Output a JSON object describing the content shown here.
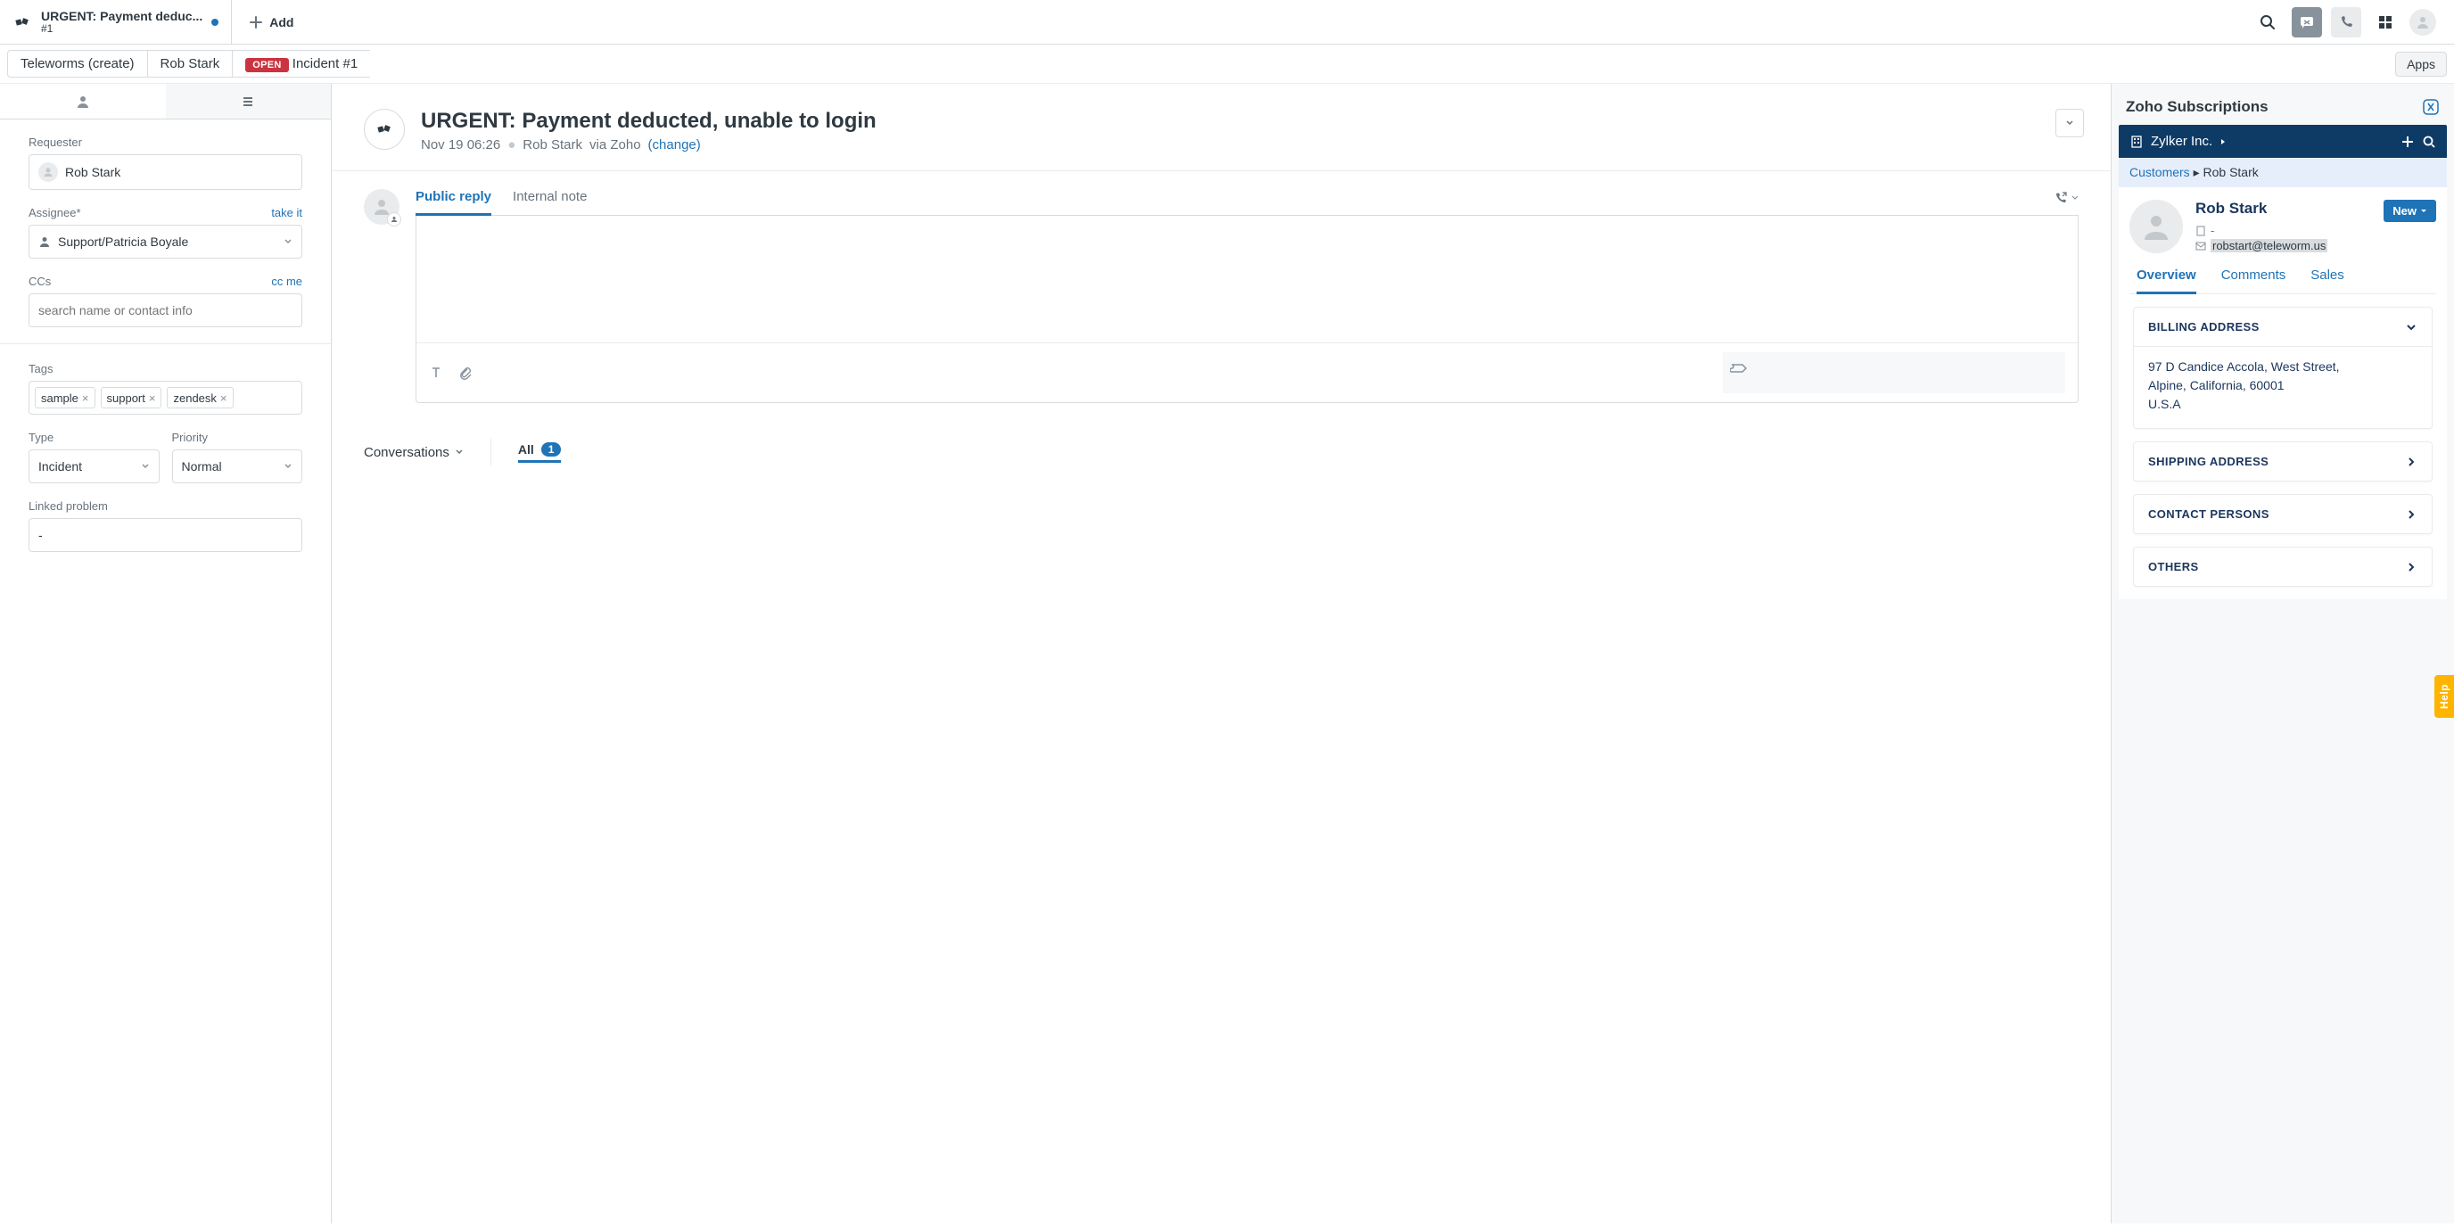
{
  "topTab": {
    "title": "URGENT: Payment deduc...",
    "sub": "#1",
    "addLabel": "Add"
  },
  "crumbs": {
    "org": "Teleworms (create)",
    "person": "Rob Stark",
    "badge": "OPEN",
    "ticket": "Incident #1",
    "apps": "Apps"
  },
  "left": {
    "requesterLabel": "Requester",
    "requester": "Rob Stark",
    "assigneeLabel": "Assignee*",
    "takeIt": "take it",
    "assignee": "Support/Patricia Boyale",
    "ccsLabel": "CCs",
    "ccMe": "cc me",
    "ccPlaceholder": "search name or contact info",
    "tagsLabel": "Tags",
    "tags": [
      "sample",
      "support",
      "zendesk"
    ],
    "typeLabel": "Type",
    "type": "Incident",
    "priorityLabel": "Priority",
    "priority": "Normal",
    "linkedLabel": "Linked problem",
    "linked": "-"
  },
  "ticket": {
    "title": "URGENT: Payment deducted, unable to login",
    "date": "Nov 19 06:26",
    "author": "Rob Stark",
    "via": "via Zoho",
    "change": "(change)",
    "publicReply": "Public reply",
    "internalNote": "Internal note",
    "conversations": "Conversations",
    "filterAll": "All",
    "filterCount": "1"
  },
  "zoho": {
    "header": "Zoho Subscriptions",
    "org": "Zylker Inc.",
    "crumbCustomers": "Customers",
    "crumbName": "Rob Stark",
    "custName": "Rob Stark",
    "custCompany": "-",
    "custEmail": "robstart@teleworm.us",
    "newBtn": "New",
    "tabs": {
      "overview": "Overview",
      "comments": "Comments",
      "sales": "Sales"
    },
    "billing": {
      "label": "BILLING ADDRESS",
      "line1": "97 D Candice Accola, West Street,",
      "line2": "Alpine, California, 60001",
      "line3": "U.S.A"
    },
    "shipping": "SHIPPING ADDRESS",
    "contactPersons": "CONTACT PERSONS",
    "others": "OTHERS"
  },
  "help": "Help"
}
